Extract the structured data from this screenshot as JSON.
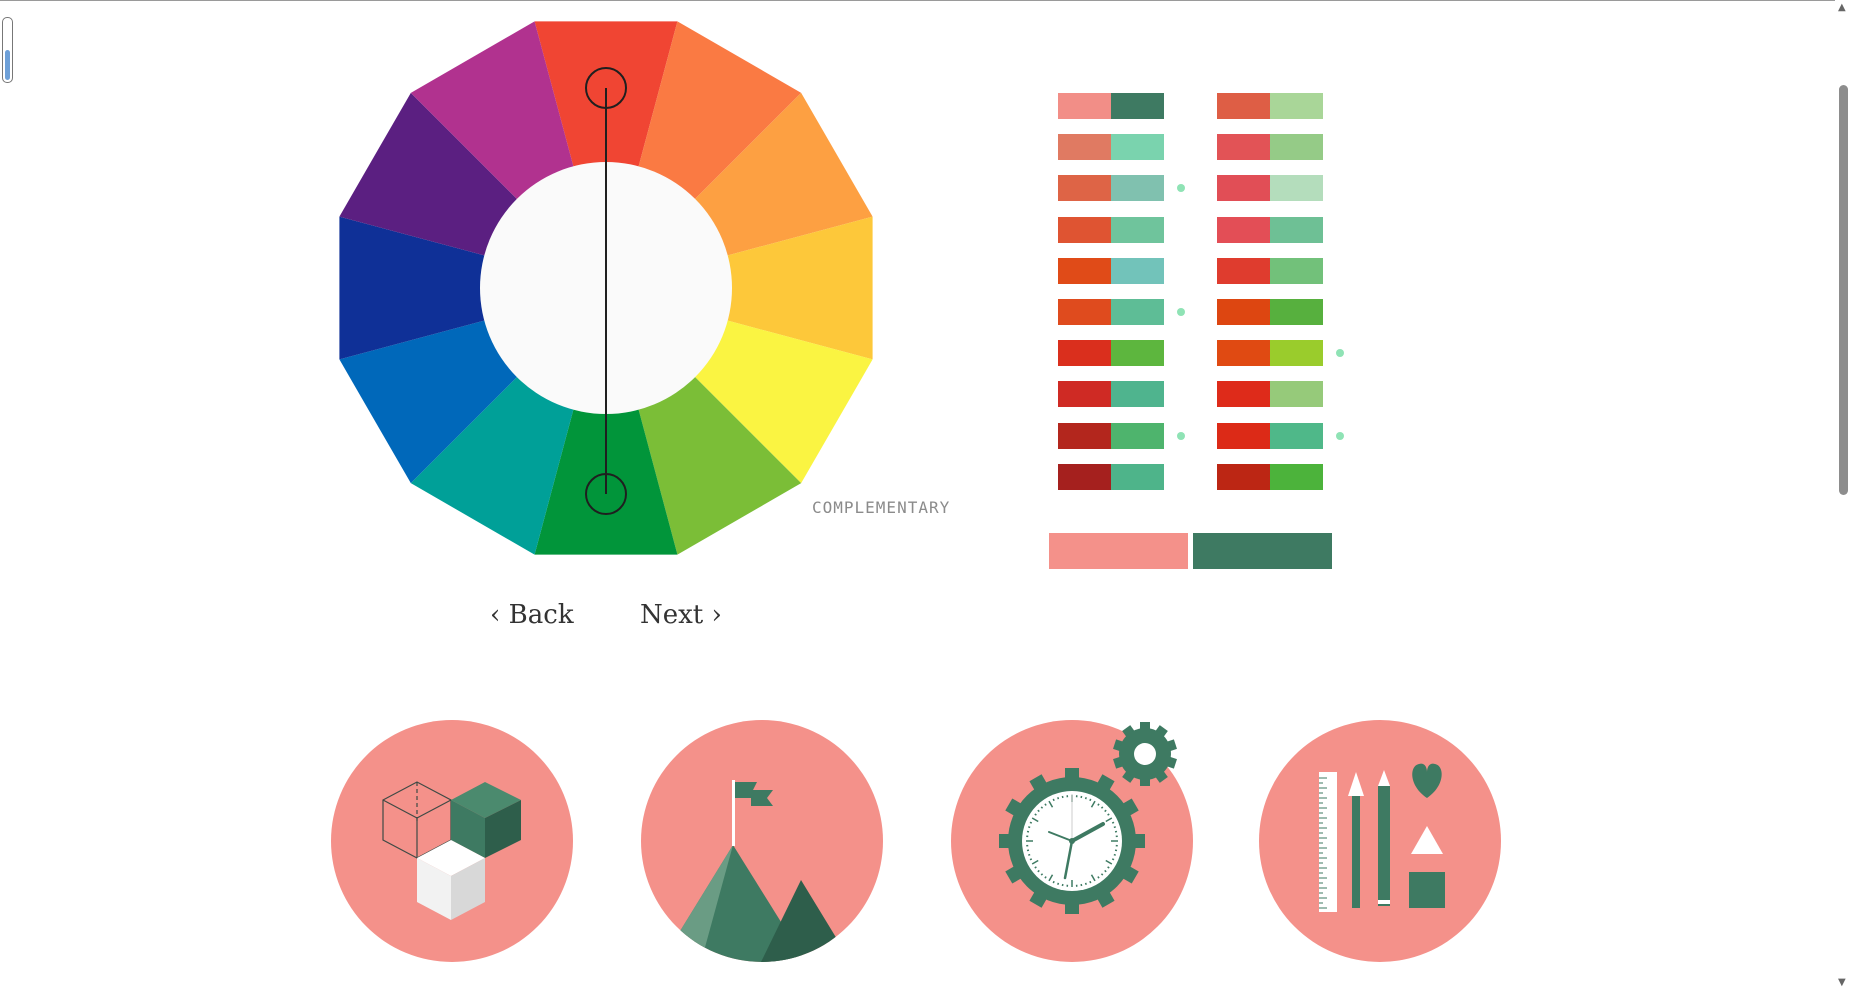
{
  "wheel": {
    "segment_colors": [
      "#F04533",
      "#FA7A43",
      "#FDA042",
      "#FDC83A",
      "#FAF442",
      "#7BBE37",
      "#01953A",
      "#00A098",
      "#0068BA",
      "#0F3097",
      "#5B1F81",
      "#B1328F"
    ],
    "center_color": "#FAFAFA",
    "selector_line_color": "#1f1f1f",
    "mode_label": "COMPLEMENTARY"
  },
  "navigation": {
    "back_label": "Back",
    "next_label": "Next"
  },
  "palette": {
    "columns": [
      {
        "pairs": [
          {
            "a": "#F28E87",
            "b": "#3E7A62",
            "dot": false
          },
          {
            "a": "#E07A62",
            "b": "#7AD3AE",
            "dot": false
          },
          {
            "a": "#DE6446",
            "b": "#80C1AF",
            "dot": true
          },
          {
            "a": "#DF5432",
            "b": "#6FC49C",
            "dot": false
          },
          {
            "a": "#E04B18",
            "b": "#72C3BA",
            "dot": false
          },
          {
            "a": "#DF4B1E",
            "b": "#5EBD96",
            "dot": true
          },
          {
            "a": "#DA2F1D",
            "b": "#5DB63E",
            "dot": false
          },
          {
            "a": "#CF2A24",
            "b": "#4FB48E",
            "dot": false
          },
          {
            "a": "#B3261D",
            "b": "#4EB46D",
            "dot": true
          },
          {
            "a": "#A5201E",
            "b": "#4EB48A",
            "dot": false
          }
        ]
      },
      {
        "pairs": [
          {
            "a": "#DE5E45",
            "b": "#A9D698",
            "dot": false
          },
          {
            "a": "#E25356",
            "b": "#95CB87",
            "dot": false
          },
          {
            "a": "#E14E56",
            "b": "#B4DDBC",
            "dot": false
          },
          {
            "a": "#E34E56",
            "b": "#6EC095",
            "dot": false
          },
          {
            "a": "#DF3C2E",
            "b": "#72C17A",
            "dot": false
          },
          {
            "a": "#DD4611",
            "b": "#57B03E",
            "dot": false
          },
          {
            "a": "#E04A12",
            "b": "#9ACC2C",
            "dot": true
          },
          {
            "a": "#DE2B1A",
            "b": "#96CA7A",
            "dot": false
          },
          {
            "a": "#DC2A17",
            "b": "#4FB889",
            "dot": true
          },
          {
            "a": "#BC2614",
            "b": "#4CB33B",
            "dot": false
          }
        ]
      }
    ],
    "selected": {
      "primary": "#F4918A",
      "secondary": "#3E7A62"
    }
  },
  "icons": {
    "circle_color": "#F4918A",
    "accent_color": "#3E7A62",
    "items": [
      "cubes-icon",
      "mountain-flag-icon",
      "clock-gear-icon",
      "design-tools-icon"
    ]
  }
}
